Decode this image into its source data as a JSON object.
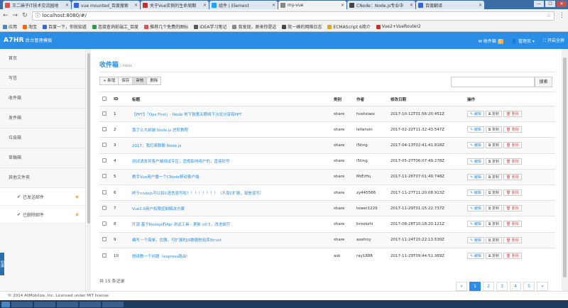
{
  "browser": {
    "tabs": [
      {
        "label": "王二麻子IT技术交流园地",
        "color": "#d9534f"
      },
      {
        "label": "vue mounted_百度搜索",
        "color": "#3565d8"
      },
      {
        "label": "关于Vue实例的生命周期",
        "color": "#c9302c"
      },
      {
        "label": "组件 | Element",
        "color": "#20a0ff"
      },
      {
        "label": "my-vue",
        "color": "#888888"
      },
      {
        "label": "CNode：Node.js专业中",
        "color": "#444444"
      },
      {
        "label": "百度翻译",
        "color": "#3565d8"
      }
    ],
    "url": "localhost:8080/#/",
    "bookmarks": [
      {
        "label": "应用",
        "color": "#4a86c5"
      },
      {
        "label": "淘宝",
        "color": "#f60"
      },
      {
        "label": "百度一下，你就知道",
        "color": "#3565d8"
      },
      {
        "label": "连接查询前端工_百度",
        "color": "#2a9d4a"
      },
      {
        "label": "推荐几个免费的图标",
        "color": "#d9534f"
      },
      {
        "label": "IDEA学习笔记",
        "color": "#555"
      },
      {
        "label": "我发现，原来你是这",
        "color": "#888"
      },
      {
        "label": "阮一峰的网络日志",
        "color": "#444"
      },
      {
        "label": "ECMAScript 6简介",
        "color": "#e8a317"
      },
      {
        "label": "Vue2+VueRouter2",
        "color": "#c9302c"
      }
    ]
  },
  "app": {
    "brand": "A7HR",
    "brand_sub": "后台管理模板",
    "inbox_label": "收件箱",
    "inbox_count": "5",
    "admin_label": "管理员",
    "fullscreen_label": "开启全屏"
  },
  "sidebar": {
    "items": [
      "首页",
      "写信",
      "收件箱",
      "发件箱",
      "垃圾箱",
      "草稿箱",
      "其他文件夹"
    ],
    "subitems": [
      "已发送邮件",
      "已删除邮件"
    ],
    "star": "★",
    "check": "✔"
  },
  "page": {
    "title": "收件箱",
    "subtitle": "/ Inbox",
    "toolbar": [
      "+ 新增",
      "保存",
      "审核",
      "删除"
    ],
    "search_button": "搜索",
    "columns": [
      "ID",
      "标题",
      "类别",
      "作者",
      "修改日期",
      "操作"
    ],
    "actions": [
      "编辑",
      "复制",
      "删除"
    ],
    "rows": [
      {
        "id": "1",
        "title": "【PPT】「Ops First」- Node 地下铁第五期线下沙龙分享和PPT",
        "cat": "share",
        "author": "hustxiaoc",
        "date": "2017-10-12T01:56:20.451Z"
      },
      {
        "id": "2",
        "title": "饿了么大前端 Node.js 进阶教程",
        "cat": "share",
        "author": "lellansin",
        "date": "2017-02-22T11:32:43.547Z"
      },
      {
        "id": "3",
        "title": "2017，我们来聊聊 Node.js",
        "cat": "share",
        "author": "i5ting",
        "date": "2017-04-13T02:41:41.818Z"
      },
      {
        "id": "4",
        "title": "测试请发到客户端测试专区，违规影响用户的，直接封号",
        "cat": "share",
        "author": "i5ting",
        "date": "2017-05-27T06:07:49.278Z"
      },
      {
        "id": "5",
        "title": "教手Vue用户播一个CNode移动客户端",
        "cat": "share",
        "author": "MrErHu",
        "date": "2017-11-26T07:01:49.748Z"
      },
      {
        "id": "6",
        "title": "终于nodejs可以和C语言混写啦！！！！！！！！（不靠C扩展，就是混写）",
        "cat": "share",
        "author": "zy445566",
        "date": "2017-11-27T11:20:08.913Z"
      },
      {
        "id": "7",
        "title": "Vue2.0用户权限控制解决方案",
        "cat": "share",
        "author": "tower1229",
        "date": "2017-11-29T01:15:22.737Z"
      },
      {
        "id": "8",
        "title": "开源 基于Nodejs的Api 测试工具 - 更新 v0.5，改进细节",
        "cat": "share",
        "author": "brookshi",
        "date": "2017-08-28T10:18:20.121Z"
      },
      {
        "id": "9",
        "title": "编写一个简单，优雅，可扩展的JS数据校验库Struct",
        "cat": "share",
        "author": "axetroy",
        "date": "2017-11-24T15:22:13.530Z"
      },
      {
        "id": "10",
        "title": "想请教一个问题（express路由）",
        "cat": "ask",
        "author": "ray1888",
        "date": "2017-11-29T09:44:51.369Z"
      }
    ],
    "total": "共 15 条记录",
    "pages": [
      "«",
      "1",
      "2",
      "3",
      "4",
      "5",
      "»"
    ],
    "current_page": "1"
  },
  "footer": "© 2014 AllMobilize, Inc. Licensed under MIT license."
}
